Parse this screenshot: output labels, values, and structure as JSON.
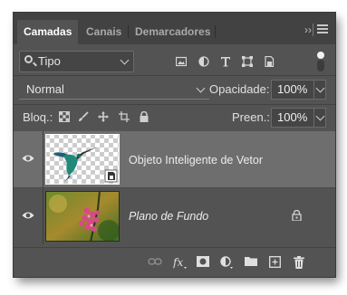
{
  "tabs": [
    {
      "label": "Camadas",
      "active": true
    },
    {
      "label": "Canais",
      "active": false
    },
    {
      "label": "Demarcadores",
      "active": false
    }
  ],
  "collapse_glyph": "››",
  "filter": {
    "label": "Tipo",
    "icons": [
      "image-filter-icon",
      "adjustment-filter-icon",
      "type-filter-icon",
      "shape-filter-icon",
      "smart-object-filter-icon"
    ]
  },
  "blend": {
    "mode": "Normal",
    "opacity_label": "Opacidade:",
    "opacity_value": "100%"
  },
  "lock": {
    "label": "Bloq.:",
    "fill_label": "Preen.:",
    "fill_value": "100%",
    "icons": [
      "lock-transparent-pixels-icon",
      "lock-image-pixels-icon",
      "lock-position-icon",
      "lock-artboard-icon",
      "lock-all-icon"
    ]
  },
  "layers": [
    {
      "name": "Objeto Inteligente de Vetor",
      "visible": true,
      "selected": true,
      "type": "smart-object"
    },
    {
      "name": "Plano de Fundo",
      "visible": true,
      "selected": false,
      "locked": true,
      "italic": true
    }
  ],
  "bottom_icons": [
    "link-layers-icon",
    "fx-icon",
    "add-mask-icon",
    "new-adjustment-layer-icon",
    "new-group-icon",
    "new-layer-icon",
    "delete-icon"
  ],
  "colors": {
    "panel": "#535353",
    "tabbar": "#424242",
    "selected_row": "#6e6e6e"
  }
}
